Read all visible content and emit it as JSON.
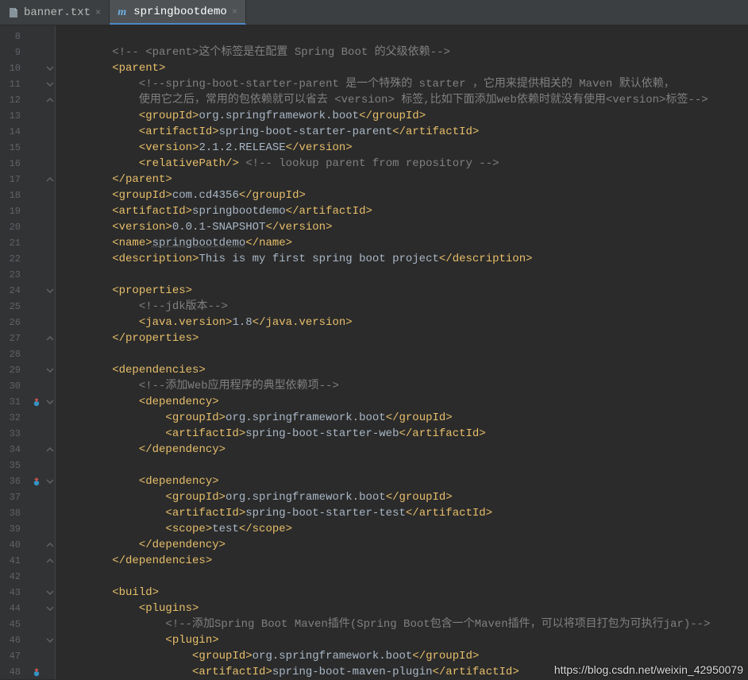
{
  "tabs": [
    {
      "label": "banner.txt",
      "active": false
    },
    {
      "label": "springbootdemo",
      "active": true
    }
  ],
  "lineStart": 8,
  "lineEnd": 48,
  "watermark": "https://blog.csdn.net/weixin_42950079",
  "code": {
    "l8": "",
    "l9": {
      "pre": "        ",
      "cmt": "<!-- <parent>这个标签是在配置 Spring Boot 的父级依赖-->"
    },
    "l10": {
      "pre": "        ",
      "o": "<parent>"
    },
    "l11": {
      "pre": "            ",
      "cmt": "<!--spring-boot-starter-parent 是一个特殊的 starter ，它用来提供相关的 Maven 默认依赖，"
    },
    "l12": {
      "pre": "            ",
      "cmt": "使用它之后，常用的包依赖就可以省去 <version> 标签,比如下面添加web依赖时就没有使用<version>标签-->"
    },
    "l13": {
      "pre": "            ",
      "o": "<groupId>",
      "t": "org.springframework.boot",
      "c": "</groupId>"
    },
    "l14": {
      "pre": "            ",
      "o": "<artifactId>",
      "t": "spring-boot-starter-parent",
      "c": "</artifactId>"
    },
    "l15": {
      "pre": "            ",
      "o": "<version>",
      "t": "2.1.2.RELEASE",
      "c": "</version>"
    },
    "l16": {
      "pre": "            ",
      "o": "<relativePath/>",
      "cmt": " <!-- lookup parent from repository -->"
    },
    "l17": {
      "pre": "        ",
      "o": "</parent>"
    },
    "l18": {
      "pre": "        ",
      "o": "<groupId>",
      "t": "com.cd4356",
      "c": "</groupId>"
    },
    "l19": {
      "pre": "        ",
      "o": "<artifactId>",
      "t": "springbootdemo",
      "c": "</artifactId>"
    },
    "l20": {
      "pre": "        ",
      "o": "<version>",
      "t": "0.0.1-SNAPSHOT",
      "c": "</version>"
    },
    "l21": {
      "pre": "        ",
      "o": "<name>",
      "t": "springbootdemo",
      "c": "</name>",
      "und": true
    },
    "l22": {
      "pre": "        ",
      "o": "<description>",
      "t": "This is my first spring boot project",
      "c": "</description>"
    },
    "l23": "",
    "l24": {
      "pre": "        ",
      "o": "<properties>"
    },
    "l25": {
      "pre": "            ",
      "cmt": "<!--jdk版本-->"
    },
    "l26": {
      "pre": "            ",
      "o": "<java.version>",
      "t": "1.8",
      "c": "</java.version>"
    },
    "l27": {
      "pre": "        ",
      "o": "</properties>"
    },
    "l28": "",
    "l29": {
      "pre": "        ",
      "o": "<dependencies>"
    },
    "l30": {
      "pre": "            ",
      "cmt": "<!--添加Web应用程序的典型依赖项-->"
    },
    "l31": {
      "pre": "            ",
      "o": "<dependency>"
    },
    "l32": {
      "pre": "                ",
      "o": "<groupId>",
      "t": "org.springframework.boot",
      "c": "</groupId>"
    },
    "l33": {
      "pre": "                ",
      "o": "<artifactId>",
      "t": "spring-boot-starter-web",
      "c": "</artifactId>"
    },
    "l34": {
      "pre": "            ",
      "o": "</dependency>"
    },
    "l35": "",
    "l36": {
      "pre": "            ",
      "o": "<dependency>"
    },
    "l37": {
      "pre": "                ",
      "o": "<groupId>",
      "t": "org.springframework.boot",
      "c": "</groupId>"
    },
    "l38": {
      "pre": "                ",
      "o": "<artifactId>",
      "t": "spring-boot-starter-test",
      "c": "</artifactId>"
    },
    "l39": {
      "pre": "                ",
      "o": "<scope>",
      "t": "test",
      "c": "</scope>"
    },
    "l40": {
      "pre": "            ",
      "o": "</dependency>"
    },
    "l41": {
      "pre": "        ",
      "o": "</dependencies>"
    },
    "l42": "",
    "l43": {
      "pre": "        ",
      "o": "<build>"
    },
    "l44": {
      "pre": "            ",
      "o": "<plugins>"
    },
    "l45": {
      "pre": "                ",
      "cmt": "<!--添加Spring Boot Maven插件(Spring Boot包含一个Maven插件，可以将项目打包为可执行jar)-->"
    },
    "l46": {
      "pre": "                ",
      "o": "<plugin>"
    },
    "l47": {
      "pre": "                    ",
      "o": "<groupId>",
      "t": "org.springframework.boot",
      "c": "</groupId>"
    },
    "l48": {
      "pre": "                    ",
      "o": "<artifactId>",
      "t": "spring-boot-maven-plugin",
      "c": "</artifactId>"
    }
  },
  "markers": {
    "31": "override",
    "36": "override",
    "48": "override"
  },
  "folds": {
    "10": "open",
    "11": "open",
    "12": "close",
    "17": "close",
    "24": "open",
    "27": "close",
    "29": "open",
    "31": "open",
    "34": "close",
    "36": "open",
    "40": "close",
    "41": "close",
    "43": "open",
    "44": "open",
    "46": "open"
  }
}
